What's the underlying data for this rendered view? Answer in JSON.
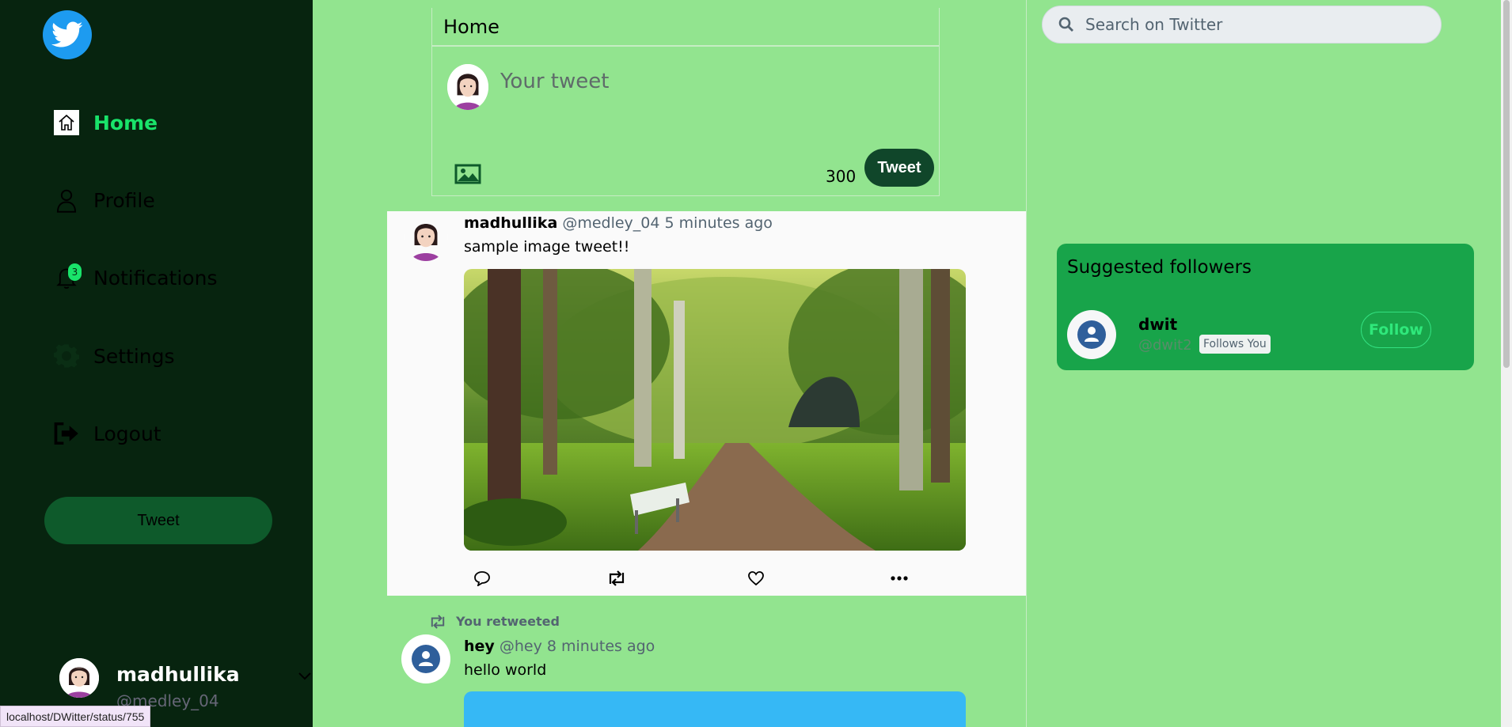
{
  "sidebar": {
    "nav": [
      {
        "label": "Home",
        "icon": "home-icon"
      },
      {
        "label": "Profile",
        "icon": "profile-icon"
      },
      {
        "label": "Notifications",
        "icon": "bell-icon",
        "badge": "3"
      },
      {
        "label": "Settings",
        "icon": "gear-icon"
      },
      {
        "label": "Logout",
        "icon": "logout-icon"
      }
    ],
    "tweet_button": "Tweet",
    "user": {
      "name": "madhullika",
      "handle": "@medley_04"
    }
  },
  "compose": {
    "title": "Home",
    "placeholder": "Your tweet",
    "char_count": "300",
    "tweet_button": "Tweet"
  },
  "feed": [
    {
      "name": "madhullika",
      "handle": "@medley_04",
      "time": "5 minutes ago",
      "text": "sample image tweet!!"
    },
    {
      "retweet_label": "You retweeted",
      "name": "hey",
      "handle": "@hey",
      "time": "8 minutes ago",
      "text": "hello world"
    }
  ],
  "search": {
    "placeholder": "Search on Twitter"
  },
  "suggested": {
    "title": "Suggested followers",
    "user": {
      "name": "dwit",
      "handle": "@dwit2",
      "badge": "Follows You"
    },
    "follow_button": "Follow"
  },
  "statusbar": "localhost/DWitter/status/755",
  "colors": {
    "page_bg": "#92e48f",
    "sidebar_bg": "#07240f",
    "accent": "#19e36a",
    "tweet_button": "#10462a",
    "suggest_bg": "#18a44a",
    "twitter_blue": "#1d9bf0"
  }
}
